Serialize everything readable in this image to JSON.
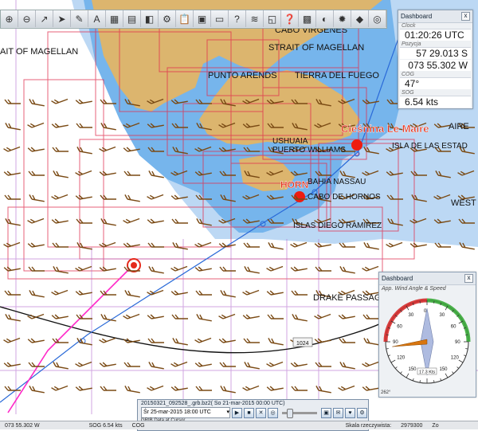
{
  "map": {
    "labels": {
      "strait_left": "AIT OF MAGELLAN",
      "strait_right": "STRAIT OF MAGELLAN",
      "cabo_virgenes": "CABO VIRGENES",
      "punto_arends": "PUNTO ARENDS",
      "tierra_del_fuego": "TIERRA DEL FUEGO",
      "ushuaia": "USHUAIA",
      "puerto_williams": "PUERTO WILLIAMS",
      "isla_estados": "ISLA DE LAS ESTAD",
      "aire": "AIRE",
      "bahia_nassau": "BAHIA NASSAU",
      "cabo_de_hornos": "CABO DE HORNOS",
      "west": "WEST",
      "islas_diego_ramirez": "ISLAS DIEGO RAMIREZ",
      "drake": "DRAKE PASSAGE",
      "depth_1024": "1024",
      "cieslnina": "Cieśnina Le Maire",
      "horn": "HORN"
    },
    "colors": {
      "sea": "#ffffff",
      "shallow": "#76b5ec",
      "deep": "#bcd8f4",
      "land": "#dcb56e",
      "chart_border": "#e02c4c",
      "route": "#2a6ad8",
      "track": "#ff28c8",
      "wind_barb": "#7a4a14",
      "waypoint": "#ee1c10"
    }
  },
  "toolbar": {
    "buttons": [
      "zoom-in",
      "zoom-out",
      "route",
      "ship",
      "pencil",
      "text-A",
      "chart",
      "grid",
      "layers",
      "settings",
      "clipboard",
      "dashboard",
      "monitor",
      "help-chart",
      "tide",
      "chart-2",
      "question",
      "gallery",
      "photo",
      "gear",
      "dog",
      "life-ring"
    ]
  },
  "dashboard_top": {
    "title": "Dashboard",
    "close": "x",
    "clock_label": "Clock",
    "clock_value": "01:20:26 UTC",
    "position_label": "Pozycja",
    "lat_value": "57 29.013 S",
    "lon_value": "073 55.302 W",
    "cog_label": "COG",
    "cog_value": "47°",
    "sog_label": "SOG",
    "sog_value": "6.54 kts"
  },
  "dashboard_wind": {
    "title": "Dashboard",
    "close": "x",
    "subtitle": "App. Wind Angle & Speed",
    "speed_readout": "17.3 Kts",
    "angle_readout": "262°",
    "angle_deg": 262,
    "scale_labels": [
      "0",
      "30",
      "60",
      "90",
      "120",
      "150",
      "180",
      "150",
      "120",
      "90",
      "60",
      "30"
    ]
  },
  "grib": {
    "title": "20150321_092528_.grb.bz2( So 21-mar-2015 00:00  UTC)",
    "time_select": "Śr 25-mar-2015 18:00  UTC",
    "sub_label": "GRIB Data at Cursor"
  },
  "statusbar": {
    "lon": "073 55.302 W",
    "sog": "SOG 6.54 kts",
    "cog": "COG",
    "scale_label": "Skala rzeczywista:",
    "scale_value": "2979300",
    "zoom": "Zo"
  }
}
